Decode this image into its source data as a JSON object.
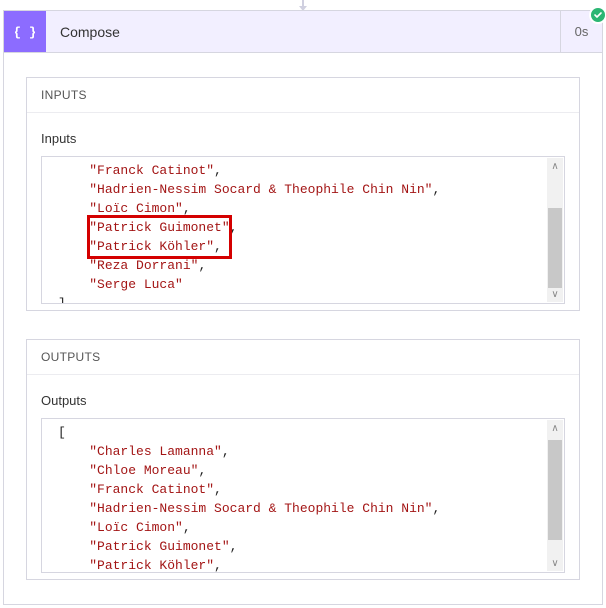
{
  "header": {
    "title": "Compose",
    "duration": "0s",
    "icon": "compose-icon"
  },
  "status": "success",
  "sections": {
    "inputs": {
      "header": "INPUTS",
      "field_label": "Inputs",
      "lines": [
        {
          "indent": 2,
          "text": "\"Franck Catinot\"",
          "comma": true
        },
        {
          "indent": 2,
          "text": "\"Hadrien-Nessim Socard & Theophile Chin Nin\"",
          "comma": true
        },
        {
          "indent": 2,
          "text": "\"Loïc Cimon\"",
          "comma": true
        },
        {
          "indent": 2,
          "text": "\"Patrick Guimonet\"",
          "comma": true
        },
        {
          "indent": 2,
          "text": "\"Patrick Köhler\"",
          "comma": true
        },
        {
          "indent": 2,
          "text": "\"Reza Dorrani\"",
          "comma": true
        },
        {
          "indent": 2,
          "text": "\"Serge Luca\"",
          "comma": false
        }
      ],
      "closing_bracket": "]"
    },
    "outputs": {
      "header": "OUTPUTS",
      "field_label": "Outputs",
      "opening_bracket": "[",
      "lines": [
        {
          "indent": 2,
          "text": "\"Charles Lamanna\"",
          "comma": true
        },
        {
          "indent": 2,
          "text": "\"Chloe Moreau\"",
          "comma": true
        },
        {
          "indent": 2,
          "text": "\"Franck Catinot\"",
          "comma": true
        },
        {
          "indent": 2,
          "text": "\"Hadrien-Nessim Socard & Theophile Chin Nin\"",
          "comma": true
        },
        {
          "indent": 2,
          "text": "\"Loïc Cimon\"",
          "comma": true
        },
        {
          "indent": 2,
          "text": "\"Patrick Guimonet\"",
          "comma": true
        },
        {
          "indent": 2,
          "text": "\"Patrick Köhler\"",
          "comma": true
        }
      ]
    }
  },
  "highlight": {
    "target_line_text": "\"Patrick Köhler\","
  }
}
